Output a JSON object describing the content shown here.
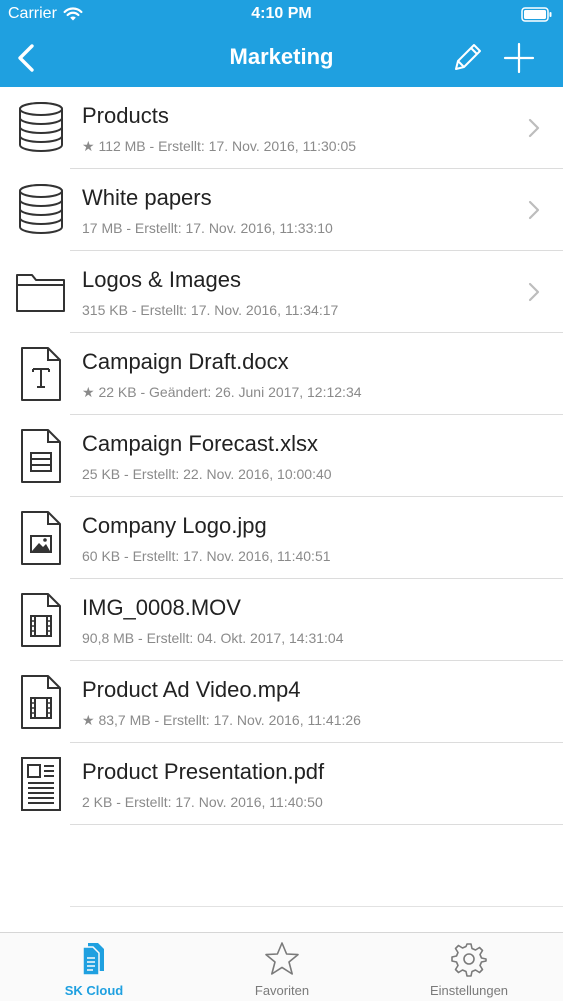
{
  "status_bar": {
    "carrier": "Carrier",
    "time": "4:10 PM"
  },
  "nav": {
    "title": "Marketing"
  },
  "items": [
    {
      "title": "Products",
      "meta": "★ 112 MB - Erstellt: 17. Nov. 2016, 11:30:05",
      "icon": "database-icon"
    },
    {
      "title": "White papers",
      "meta": "17 MB - Erstellt: 17. Nov. 2016, 11:33:10",
      "icon": "database-icon"
    },
    {
      "title": "Logos & Images",
      "meta": "315 KB - Erstellt: 17. Nov. 2016, 11:34:17",
      "icon": "folder-icon"
    },
    {
      "title": "Campaign Draft.docx",
      "meta": "★ 22 KB - Geändert: 26. Juni 2017, 12:12:34",
      "icon": "text-document-icon"
    },
    {
      "title": "Campaign Forecast.xlsx",
      "meta": "25 KB - Erstellt: 22. Nov. 2016, 10:00:40",
      "icon": "spreadsheet-icon"
    },
    {
      "title": "Company Logo.jpg",
      "meta": "60 KB - Erstellt: 17. Nov. 2016, 11:40:51",
      "icon": "image-file-icon"
    },
    {
      "title": "IMG_0008.MOV",
      "meta": "90,8 MB - Erstellt: 04. Okt. 2017, 14:31:04",
      "icon": "video-file-icon"
    },
    {
      "title": "Product Ad Video.mp4",
      "meta": "★ 83,7 MB - Erstellt: 17. Nov. 2016, 11:41:26",
      "icon": "video-file-icon"
    },
    {
      "title": "Product Presentation.pdf",
      "meta": "2 KB - Erstellt: 17. Nov. 2016, 11:40:50",
      "icon": "pdf-document-icon"
    }
  ],
  "tabs": [
    {
      "label": "SK Cloud",
      "icon": "cloud-documents-icon",
      "active": true
    },
    {
      "label": "Favoriten",
      "icon": "star-icon",
      "active": false
    },
    {
      "label": "Einstellungen",
      "icon": "gear-icon",
      "active": false
    }
  ],
  "colors": {
    "accent": "#1fa0e0",
    "meta_text": "#8a8a8a",
    "separator": "#dcdcdc"
  }
}
